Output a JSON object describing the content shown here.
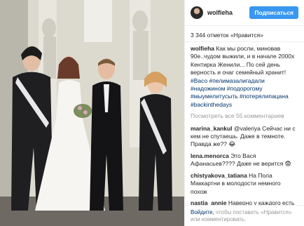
{
  "post": {
    "username": "wolfieha",
    "follow_label": "Подписаться",
    "likes_text": "3 344 отметок «Нравится»"
  },
  "caption": {
    "username": "wolfieha",
    "text": "Как мы росли, миновав 90е..чудом выжили, и в начале 2000х Кентирка Женили... По сей день верность и очаг семейный хранит!",
    "hashtags": "#Васо #пелимазалигадали #надожином #подорогому #мыумелитусыть #потерялипацана #backinthedays"
  },
  "view_more": "Посмотреть все 55 комментариев",
  "comments": [
    {
      "user": "marina_kankul",
      "text": "@valeriya Сейчас ни с кем не спутаешь. Даже в темноте. Правда же?? 😂"
    },
    {
      "user": "lena.menorca",
      "text": "Это Вася Афанасьев???? Даже не верится 😨"
    },
    {
      "user": "chistyakova_tatiana",
      "text": "На Пола Маккартни в молодости немного похож"
    },
    {
      "user": "nastja_annie",
      "text": "Наверно у каждого есть фотки, на которые смотришь и думаешь ... О Боже, кто это 😂"
    }
  ],
  "footer": {
    "prefix": "Войдите,",
    "middle": "чтобы поставить",
    "like": "«Нравится»",
    "or": "или",
    "comment": "комментировать."
  }
}
